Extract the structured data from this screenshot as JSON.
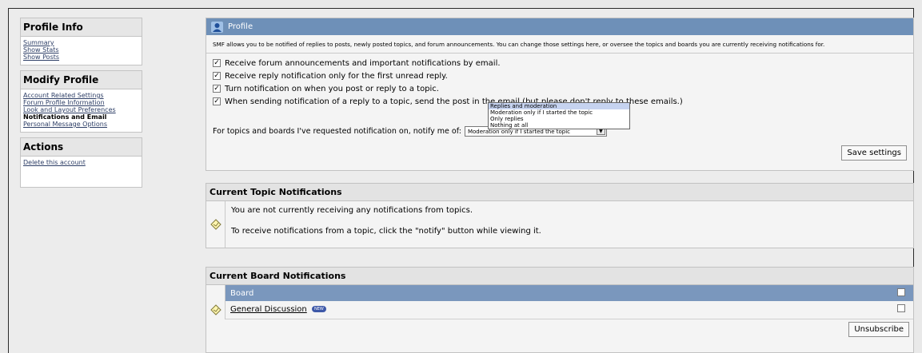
{
  "sidebar": {
    "profile_info": {
      "title": "Profile Info",
      "links": [
        "Summary",
        "Show Stats",
        "Show Posts"
      ]
    },
    "modify_profile": {
      "title": "Modify Profile",
      "links": [
        "Account Related Settings",
        "Forum Profile Information",
        "Look and Layout Preferences",
        "Notifications and Email",
        "Personal Message Options"
      ],
      "active": "Notifications and Email"
    },
    "actions": {
      "title": "Actions",
      "links": [
        "Delete this account"
      ]
    }
  },
  "profile": {
    "header": "Profile",
    "intro": "SMF allows you to be notified of replies to posts, newly posted topics, and forum announcements. You can change those settings here, or oversee the topics and boards you are currently receiving notifications for.",
    "options": [
      {
        "label": "Receive forum announcements and important notifications by email.",
        "checked": true
      },
      {
        "label": "Receive reply notification only for the first unread reply.",
        "checked": true
      },
      {
        "label": "Turn notification on when you post or reply to a topic.",
        "checked": true
      },
      {
        "label": "When sending notification of a reply to a topic, send the post in the email (but please don't reply to these emails.)",
        "checked": true
      }
    ],
    "notify_label": "For topics and boards I've requested notification on, notify me of:",
    "notify_selected": "Moderation only if I started the topic",
    "notify_options": [
      "Replies and moderation",
      "Moderation only if I started the topic",
      "Only replies",
      "Nothing at all"
    ],
    "notify_highlighted": "Replies and moderation",
    "save_label": "Save settings"
  },
  "topic_notifications": {
    "title": "Current Topic Notifications",
    "line1": "You are not currently receiving any notifications from topics.",
    "line2": "To receive notifications from a topic, click the \"notify\" button while viewing it."
  },
  "board_notifications": {
    "title": "Current Board Notifications",
    "column": "Board",
    "rows": [
      {
        "name": "General Discussion",
        "badge": "NEW"
      }
    ],
    "unsubscribe_label": "Unsubscribe"
  },
  "colors": {
    "header_blue": "#6e90b8",
    "table_head_blue": "#7a97bd",
    "link": "#2d3e66"
  }
}
